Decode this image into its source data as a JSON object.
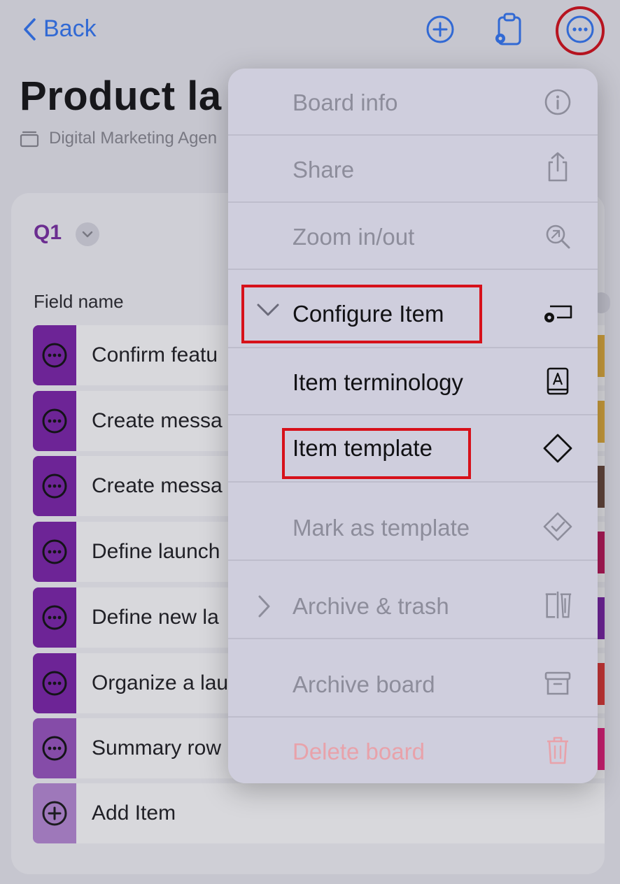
{
  "nav": {
    "back_label": "Back"
  },
  "header": {
    "title": "Product la",
    "subtitle": "Digital Marketing Agen"
  },
  "board": {
    "group_name": "Q1",
    "field_header": "Field name",
    "rows": [
      {
        "label": "Confirm featu",
        "handle_color": "#7d24aa",
        "status_color": "#e8b33b"
      },
      {
        "label": "Create messa",
        "handle_color": "#7d24aa",
        "status_color": "#e8b33b"
      },
      {
        "label": "Create messa",
        "handle_color": "#7d24aa",
        "status_color": "#6b4a3a"
      },
      {
        "label": "Define launch",
        "handle_color": "#7d24aa",
        "status_color": "#c2185b"
      },
      {
        "label": "Define new la",
        "handle_color": "#7d24aa",
        "status_color": "#7d24aa"
      },
      {
        "label": "Organize a lau",
        "handle_color": "#7d24aa",
        "status_color": "#e53935"
      },
      {
        "label": "Summary row",
        "handle_color": "#9a55c0",
        "status_color": "#e91e7a"
      }
    ],
    "add_item_label": "Add Item",
    "add_item_color": "#b98ad6"
  },
  "menu": {
    "items": [
      {
        "label": "Board info",
        "icon": "info-icon",
        "state": "disabled"
      },
      {
        "label": "Share",
        "icon": "share-icon",
        "state": "disabled"
      },
      {
        "label": "Zoom in/out",
        "icon": "zoom-icon",
        "state": "disabled"
      },
      {
        "label": "Configure Item",
        "icon": "configure-item-icon",
        "state": "enabled",
        "chevron": "chevron-down-icon"
      },
      {
        "label": "Item terminology",
        "icon": "book-icon",
        "state": "enabled"
      },
      {
        "label": "Item template",
        "icon": "diamond-icon",
        "state": "enabled"
      },
      {
        "label": "Mark as template",
        "icon": "diamond-check-icon",
        "state": "disabled"
      },
      {
        "label": "Archive & trash",
        "icon": "archive-trash-icon",
        "state": "disabled",
        "chevron": "chevron-right-icon"
      },
      {
        "label": "Archive board",
        "icon": "archive-box-icon",
        "state": "disabled"
      },
      {
        "label": "Delete board",
        "icon": "trash-icon",
        "state": "danger"
      }
    ]
  },
  "colors": {
    "accent_blue": "#3478f6",
    "highlight_red": "#d7111a",
    "group_purple": "#7a2fa3"
  }
}
